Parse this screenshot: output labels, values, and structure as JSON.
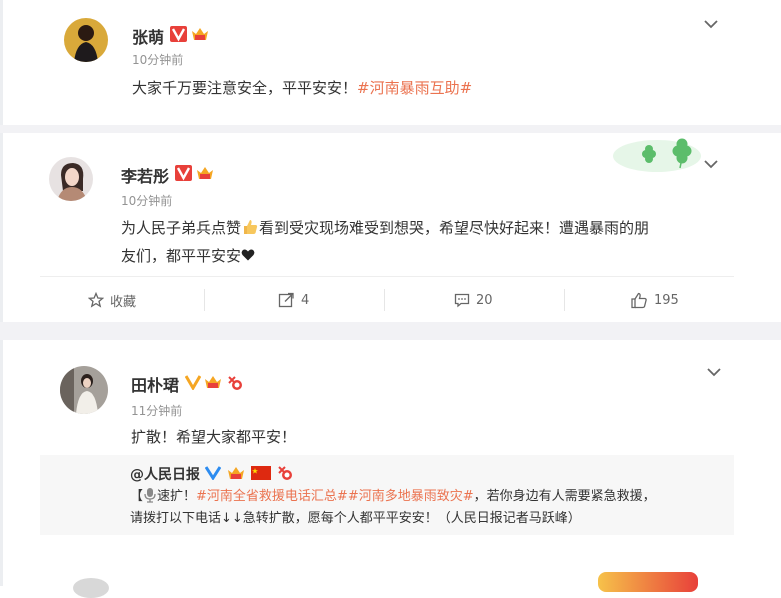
{
  "colors": {
    "accent": "#eb7350",
    "verified": "#f5a623",
    "text": "#333333",
    "muted": "#939393"
  },
  "posts": [
    {
      "name": "张萌",
      "time": "10分钟前",
      "text_plain": "大家千万要注意安全，平平安安！",
      "tag": "#河南暴雨互助#"
    },
    {
      "name": "李若彤",
      "time": "10分钟前",
      "text_line1_part1": "为人民子弟兵点赞",
      "text_line1_part2": "看到受灾现场难受到想哭，希望尽快好起来！遭遇暴雨的朋",
      "text_line2": "友们，都平平安安",
      "actions": {
        "collect": "收藏",
        "repost": "4",
        "comment": "20",
        "like": "195"
      }
    },
    {
      "name": "田朴珺",
      "time": "11分钟前",
      "text": "扩散！希望大家都平安！",
      "repost": {
        "name": "@人民日报",
        "bracket_open": "【",
        "label": "速扩！",
        "tag1": "#河南全省救援电话汇总#",
        "tag2": "#河南多地暴雨致灾#",
        "text_after": "，若你身边有人需要紧急救援，",
        "line2": "请拨打以下电话↓↓急转扩散，愿每个人都平平安安！（人民日报记者马跃峰）"
      }
    }
  ],
  "icons": [
    "verified-v-icon",
    "vip-crown-icon",
    "chevron-down-icon",
    "star-icon",
    "share-icon",
    "comment-icon",
    "like-icon",
    "clover-decoration"
  ]
}
